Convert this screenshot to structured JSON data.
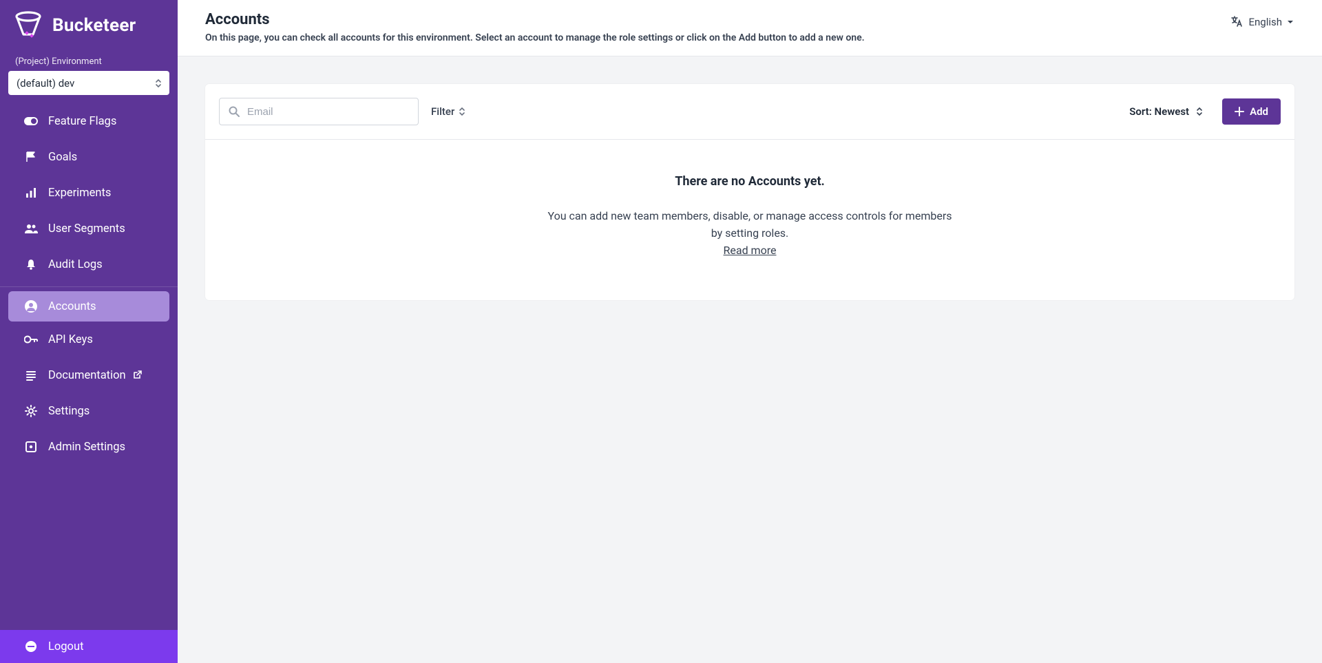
{
  "brand": {
    "name": "Bucketeer"
  },
  "sidebar": {
    "env_label": "(Project) Environment",
    "env_selected": "(default) dev",
    "items": [
      {
        "label": "Feature Flags"
      },
      {
        "label": "Goals"
      },
      {
        "label": "Experiments"
      },
      {
        "label": "User Segments"
      },
      {
        "label": "Audit Logs"
      },
      {
        "label": "Accounts"
      },
      {
        "label": "API Keys"
      },
      {
        "label": "Documentation"
      },
      {
        "label": "Settings"
      },
      {
        "label": "Admin Settings"
      }
    ],
    "logout": "Logout"
  },
  "header": {
    "title": "Accounts",
    "description": "On this page, you can check all accounts for this environment. Select an account to manage the role settings or click on the Add button to add a new one.",
    "language": "English"
  },
  "toolbar": {
    "search_placeholder": "Email",
    "filter_label": "Filter",
    "sort_label": "Sort: Newest",
    "add_label": "Add"
  },
  "empty": {
    "title": "There are no Accounts yet.",
    "desc_line1": "You can add new team members, disable, or manage access controls for members",
    "desc_line2": "by setting roles.",
    "read_more": "Read more"
  }
}
